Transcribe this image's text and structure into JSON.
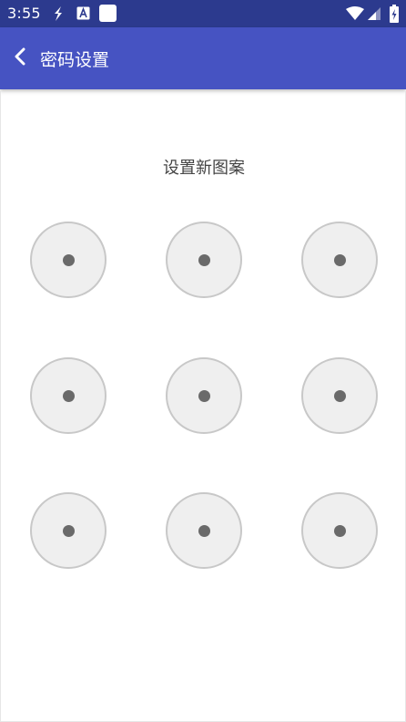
{
  "status_bar": {
    "time": "3:55",
    "icons": [
      "s-app-icon",
      "a-app-icon",
      "square-app-icon",
      "wifi-icon",
      "signal-icon",
      "battery-icon"
    ]
  },
  "app_bar": {
    "title": "密码设置",
    "back_icon": "chevron-left-icon"
  },
  "pattern": {
    "prompt": "设置新图案",
    "rows": 3,
    "cols": 3,
    "nodes": [
      1,
      2,
      3,
      4,
      5,
      6,
      7,
      8,
      9
    ]
  },
  "colors": {
    "status_bar": "#2c3a8e",
    "app_bar": "#4653c2",
    "node_fill": "#efefef",
    "node_border": "#c8c8c8",
    "node_dot": "#6a6a6a"
  }
}
